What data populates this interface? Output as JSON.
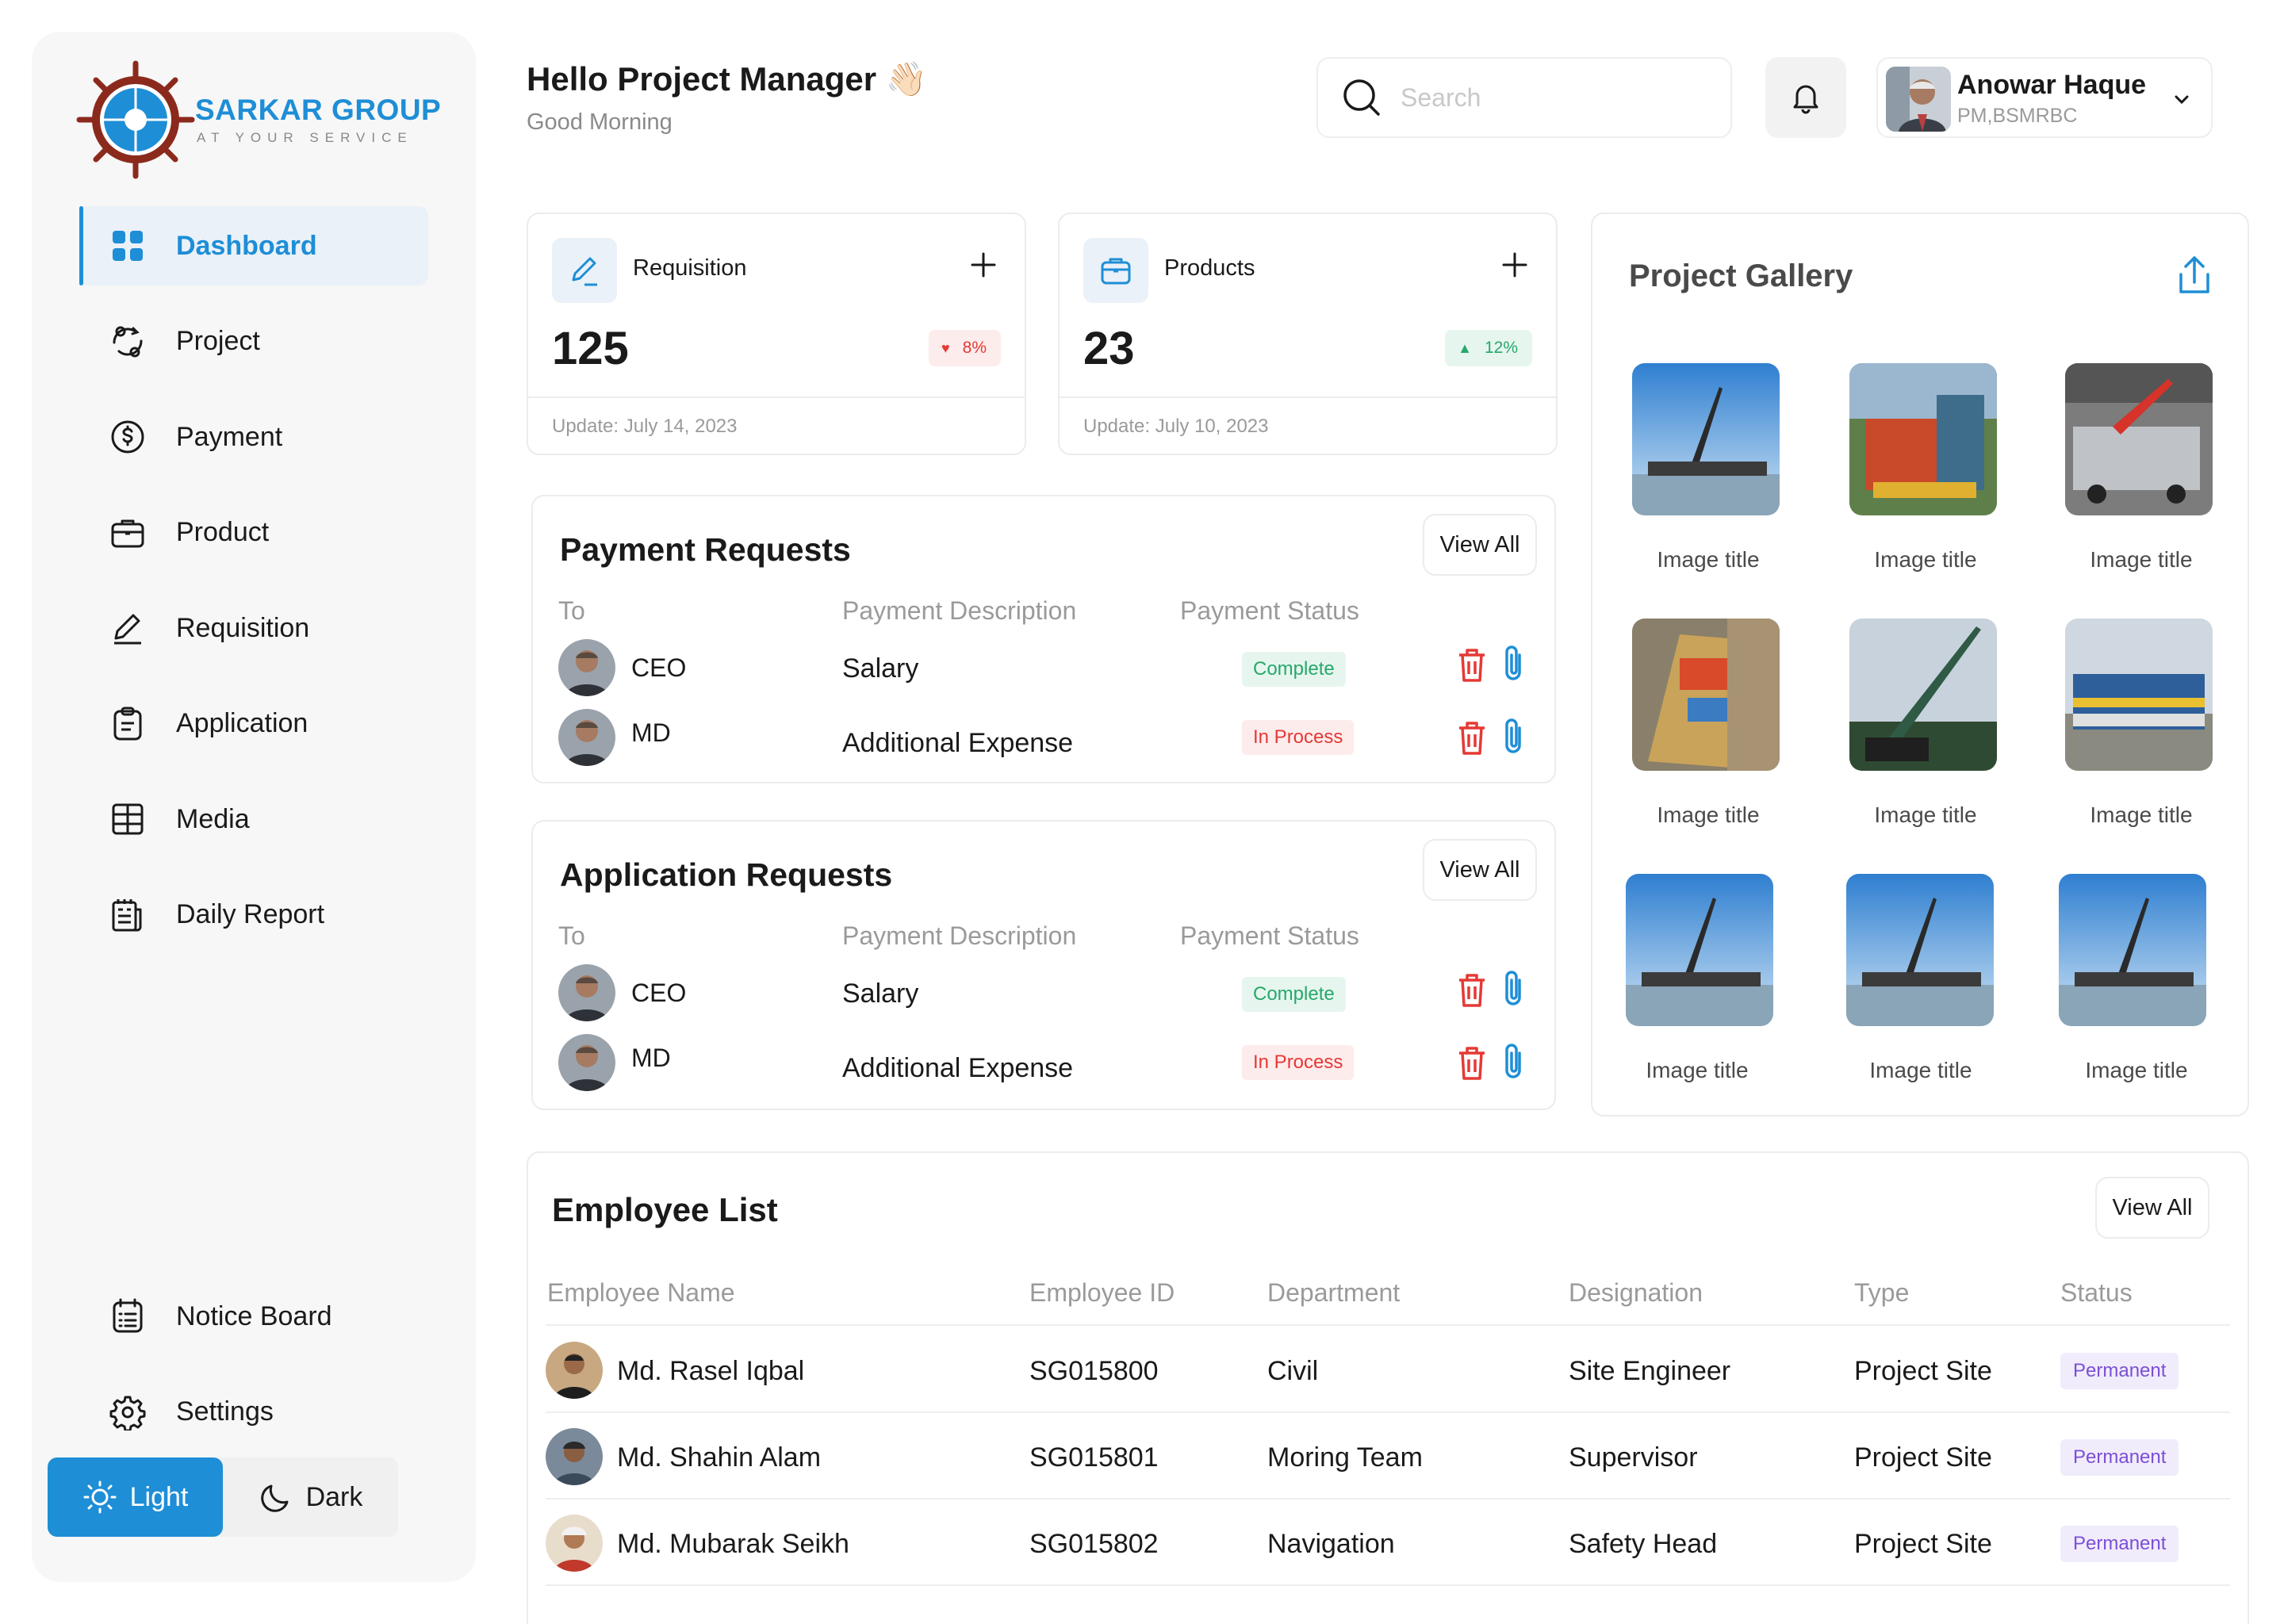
{
  "brand": {
    "name": "SARKAR GROUP",
    "tagline": "AT YOUR SERVICE",
    "color": "#1e8ed6"
  },
  "sidebar": {
    "items": [
      {
        "label": "Dashboard",
        "icon": "dashboard-grid-icon",
        "active": true
      },
      {
        "label": "Project",
        "icon": "project-cycle-icon"
      },
      {
        "label": "Payment",
        "icon": "dollar-circle-icon"
      },
      {
        "label": "Product",
        "icon": "briefcase-icon"
      },
      {
        "label": "Requisition",
        "icon": "pen-icon"
      },
      {
        "label": "Application",
        "icon": "clipboard-icon"
      },
      {
        "label": "Media",
        "icon": "grid-table-icon"
      },
      {
        "label": "Daily Report",
        "icon": "report-icon"
      }
    ],
    "bottom": [
      {
        "label": "Notice Board",
        "icon": "notice-list-icon"
      },
      {
        "label": "Settings",
        "icon": "gear-icon"
      }
    ],
    "theme": {
      "light": "Light",
      "dark": "Dark",
      "selected": "Light"
    }
  },
  "header": {
    "title": "Hello Project Manager 👋🏻",
    "subtitle": "Good Morning",
    "search_placeholder": "Search",
    "user": {
      "name": "Anowar Haque",
      "role": "PM,BSMRBC"
    }
  },
  "stats": [
    {
      "label": "Requisition",
      "value": "125",
      "change": "8%",
      "trend": "down",
      "updated": "Update: July 14, 2023",
      "icon": "pen-icon"
    },
    {
      "label": "Products",
      "value": "23",
      "change": "12%",
      "trend": "up",
      "updated": "Update: July 10, 2023",
      "icon": "briefcase-icon"
    }
  ],
  "payment_requests": {
    "title": "Payment Requests",
    "view_all": "View All",
    "columns": [
      "To",
      "Payment Description",
      "Payment Status"
    ],
    "rows": [
      {
        "to": "CEO",
        "description": "Salary",
        "status": "Complete"
      },
      {
        "to": "MD",
        "description": "Additional Expense",
        "status": "In Process"
      }
    ]
  },
  "application_requests": {
    "title": "Application Requests",
    "view_all": "View All",
    "columns": [
      "To",
      "Payment Description",
      "Payment Status"
    ],
    "rows": [
      {
        "to": "CEO",
        "description": "Salary",
        "status": "Complete"
      },
      {
        "to": "MD",
        "description": "Additional Expense",
        "status": "In Process"
      }
    ]
  },
  "gallery": {
    "title": "Project Gallery",
    "items": [
      {
        "caption": "Image title"
      },
      {
        "caption": "Image title"
      },
      {
        "caption": "Image title"
      },
      {
        "caption": "Image title"
      },
      {
        "caption": "Image title"
      },
      {
        "caption": "Image title"
      },
      {
        "caption": "Image title"
      },
      {
        "caption": "Image title"
      },
      {
        "caption": "Image title"
      }
    ]
  },
  "employees": {
    "title": "Employee List",
    "view_all": "View All",
    "columns": [
      "Employee Name",
      "Employee ID",
      "Department",
      "Designation",
      "Type",
      "Status"
    ],
    "rows": [
      {
        "name": "Md. Rasel Iqbal",
        "id": "SG015800",
        "department": "Civil",
        "designation": "Site Engineer",
        "type": "Project Site",
        "status": "Permanent"
      },
      {
        "name": "Md. Shahin Alam",
        "id": "SG015801",
        "department": "Moring Team",
        "designation": "Supervisor",
        "type": "Project Site",
        "status": "Permanent"
      },
      {
        "name": "Md. Mubarak Seikh",
        "id": "SG015802",
        "department": "Navigation",
        "designation": "Safety Head",
        "type": "Project Site",
        "status": "Permanent"
      }
    ]
  }
}
